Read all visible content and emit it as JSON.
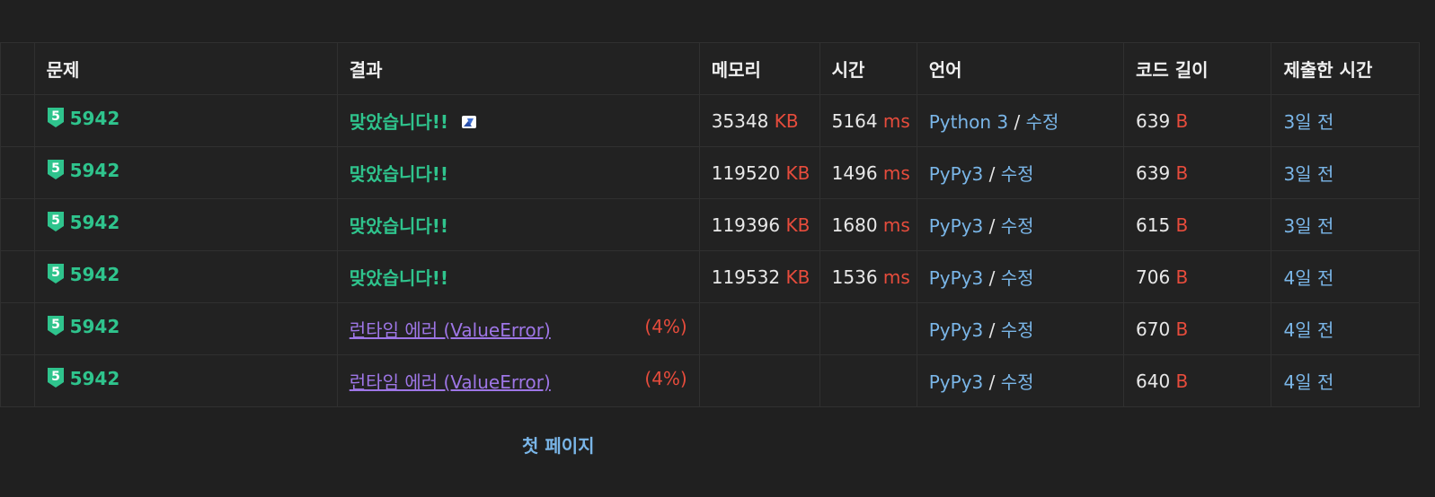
{
  "table": {
    "headers": {
      "problem": "문제",
      "result": "결과",
      "memory": "메모리",
      "time": "시간",
      "language": "언어",
      "code_length": "코드 길이",
      "submitted": "제출한 시간"
    },
    "rows": [
      {
        "problem": "5942",
        "tier": "5",
        "result": "맞았습니다!!",
        "result_type": "accepted",
        "has_share_icon": true,
        "partial": "",
        "memory": "35348",
        "memory_unit": "KB",
        "time": "5164",
        "time_unit": "ms",
        "language": "Python 3",
        "edit": "수정",
        "length": "639",
        "length_unit": "B",
        "submitted": "3일 전"
      },
      {
        "problem": "5942",
        "tier": "5",
        "result": "맞았습니다!!",
        "result_type": "accepted",
        "has_share_icon": false,
        "partial": "",
        "memory": "119520",
        "memory_unit": "KB",
        "time": "1496",
        "time_unit": "ms",
        "language": "PyPy3",
        "edit": "수정",
        "length": "639",
        "length_unit": "B",
        "submitted": "3일 전"
      },
      {
        "problem": "5942",
        "tier": "5",
        "result": "맞았습니다!!",
        "result_type": "accepted",
        "has_share_icon": false,
        "partial": "",
        "memory": "119396",
        "memory_unit": "KB",
        "time": "1680",
        "time_unit": "ms",
        "language": "PyPy3",
        "edit": "수정",
        "length": "615",
        "length_unit": "B",
        "submitted": "3일 전"
      },
      {
        "problem": "5942",
        "tier": "5",
        "result": "맞았습니다!!",
        "result_type": "accepted",
        "has_share_icon": false,
        "partial": "",
        "memory": "119532",
        "memory_unit": "KB",
        "time": "1536",
        "time_unit": "ms",
        "language": "PyPy3",
        "edit": "수정",
        "length": "706",
        "length_unit": "B",
        "submitted": "4일 전"
      },
      {
        "problem": "5942",
        "tier": "5",
        "result": "런타임 에러 (ValueError)",
        "result_type": "runtime-error",
        "has_share_icon": false,
        "partial": "(4%)",
        "memory": "",
        "memory_unit": "",
        "time": "",
        "time_unit": "",
        "language": "PyPy3",
        "edit": "수정",
        "length": "670",
        "length_unit": "B",
        "submitted": "4일 전"
      },
      {
        "problem": "5942",
        "tier": "5",
        "result": "런타임 에러 (ValueError)",
        "result_type": "runtime-error",
        "has_share_icon": false,
        "partial": "(4%)",
        "memory": "",
        "memory_unit": "",
        "time": "",
        "time_unit": "",
        "language": "PyPy3",
        "edit": "수정",
        "length": "640",
        "length_unit": "B",
        "submitted": "4일 전"
      }
    ]
  },
  "pagination": {
    "first_page": "첫 페이지"
  },
  "colors": {
    "background": "#202020",
    "accepted": "#2fc48d",
    "runtime_error": "#9e76e6",
    "unit": "#e74c3c",
    "link": "#7ab6e8"
  }
}
